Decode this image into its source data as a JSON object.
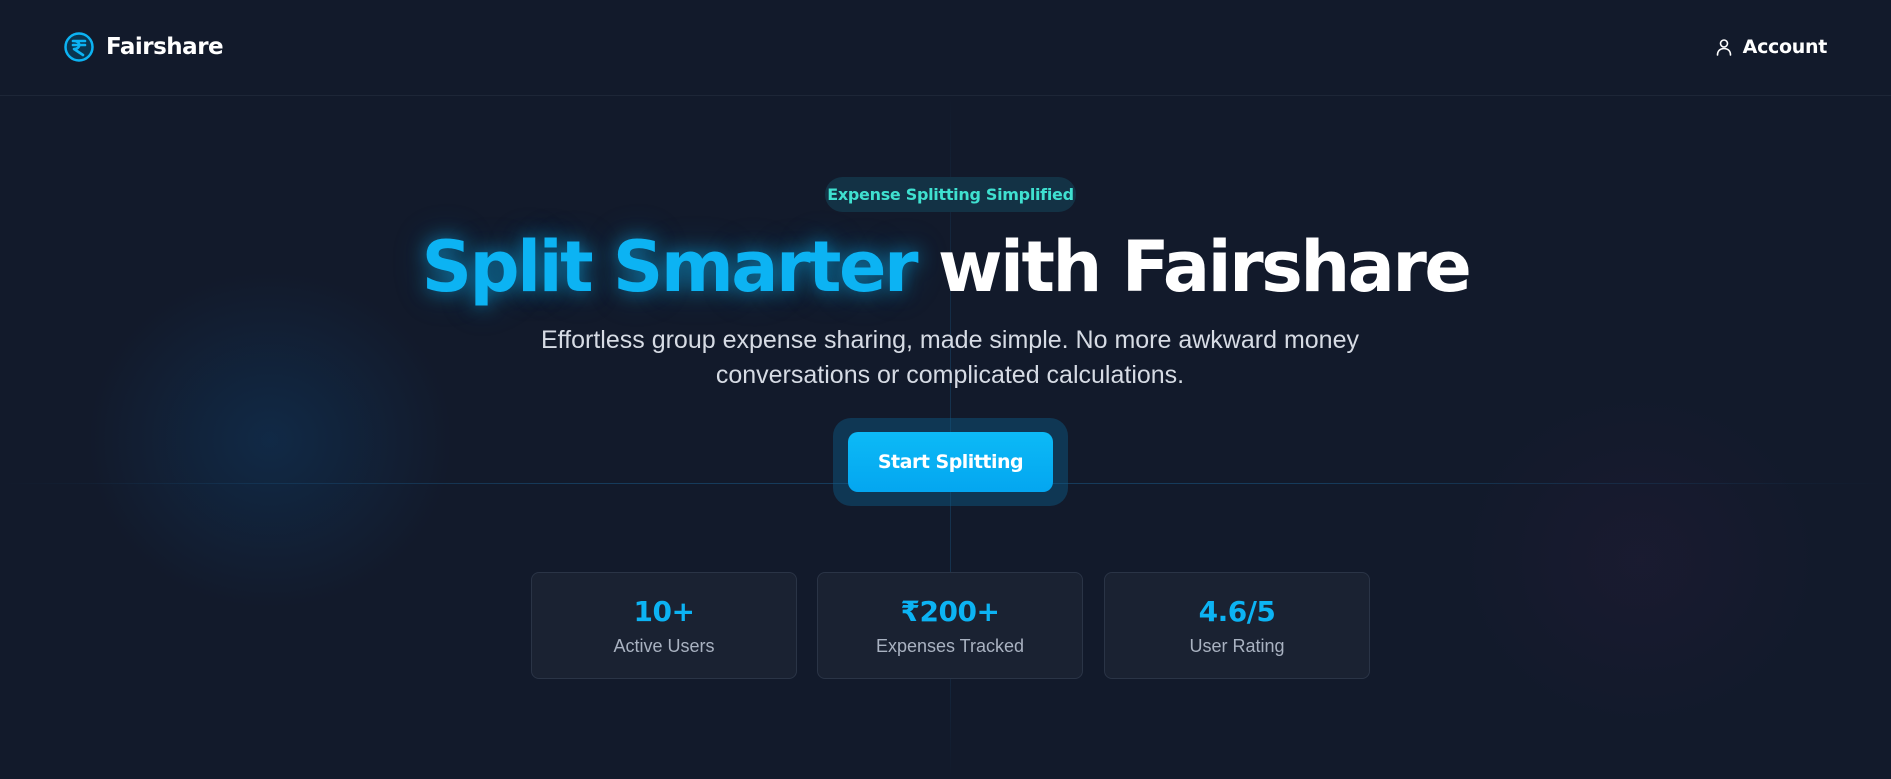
{
  "header": {
    "brand_name": "Fairshare",
    "brand_icon": "rupee-logo-icon",
    "account_label": "Account",
    "account_icon": "user-icon"
  },
  "hero": {
    "badge": "Expense Splitting Simplified",
    "headline_accent": "Split Smarter",
    "headline_rest": " with Fairshare",
    "subtitle_line1": "Effortless group expense sharing, made simple. No more awkward money",
    "subtitle_line2": "conversations or complicated calculations.",
    "cta_label": "Start Splitting"
  },
  "stats": [
    {
      "value": "10+",
      "label": "Active Users"
    },
    {
      "value": "₹200+",
      "label": "Expenses Tracked"
    },
    {
      "value": "4.6/5",
      "label": "User Rating"
    }
  ],
  "colors": {
    "background": "#121a2b",
    "accent": "#0cb3f3",
    "badge_text": "#3fe0d0",
    "card_background": "#1a2232"
  }
}
